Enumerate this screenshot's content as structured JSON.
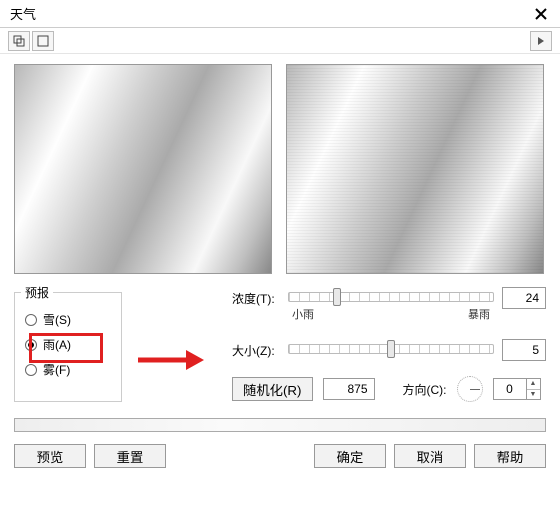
{
  "title": "天气",
  "toolbar": {
    "btn1_name": "window-mode-1",
    "btn2_name": "window-mode-2",
    "btn3_name": "arrow-right-icon"
  },
  "forecast": {
    "legend": "预报",
    "options": [
      {
        "label": "雪(S)",
        "checked": false
      },
      {
        "label": "雨(A)",
        "checked": true
      },
      {
        "label": "雾(F)",
        "checked": false
      }
    ]
  },
  "params": {
    "density": {
      "label": "浓度(T):",
      "value": "24",
      "thumbPercent": 22,
      "minLabel": "小雨",
      "maxLabel": "暴雨"
    },
    "size": {
      "label": "大小(Z):",
      "value": "5",
      "thumbPercent": 48
    },
    "randomize": {
      "button": "随机化(R)",
      "value": "875"
    },
    "direction": {
      "label": "方向(C):",
      "value": "0"
    }
  },
  "footer": {
    "preview": "预览",
    "reset": "重置",
    "ok": "确定",
    "cancel": "取消",
    "help": "帮助"
  }
}
